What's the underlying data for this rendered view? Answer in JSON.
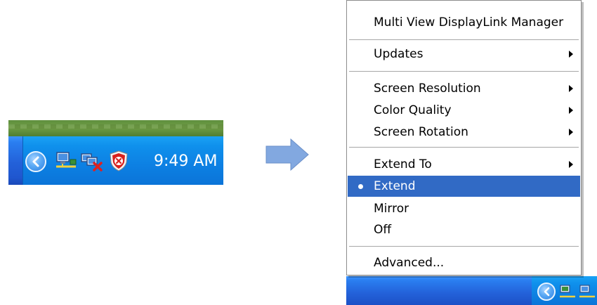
{
  "taskbar": {
    "clock": "9:49 AM",
    "tray_icons": [
      "chevron-left-icon",
      "network-icon",
      "network-disconnected-icon",
      "security-shield-icon"
    ]
  },
  "context_menu": {
    "items": [
      {
        "label": "Multi View DisplayLink Manager",
        "submenu": false
      },
      {
        "label": "Updates",
        "submenu": true
      },
      {
        "label": "Screen Resolution",
        "submenu": true
      },
      {
        "label": "Color Quality",
        "submenu": true
      },
      {
        "label": "Screen Rotation",
        "submenu": true
      },
      {
        "label": "Extend To",
        "submenu": true
      },
      {
        "label": "Extend",
        "submenu": false,
        "selected": true,
        "radio": true
      },
      {
        "label": "Mirror",
        "submenu": false
      },
      {
        "label": "Off",
        "submenu": false
      },
      {
        "label": "Advanced...",
        "submenu": false
      }
    ]
  },
  "colors": {
    "menu_highlight": "#316ac5",
    "taskbar_blue": "#2361d9",
    "tray_blue": "#0f90ec"
  }
}
